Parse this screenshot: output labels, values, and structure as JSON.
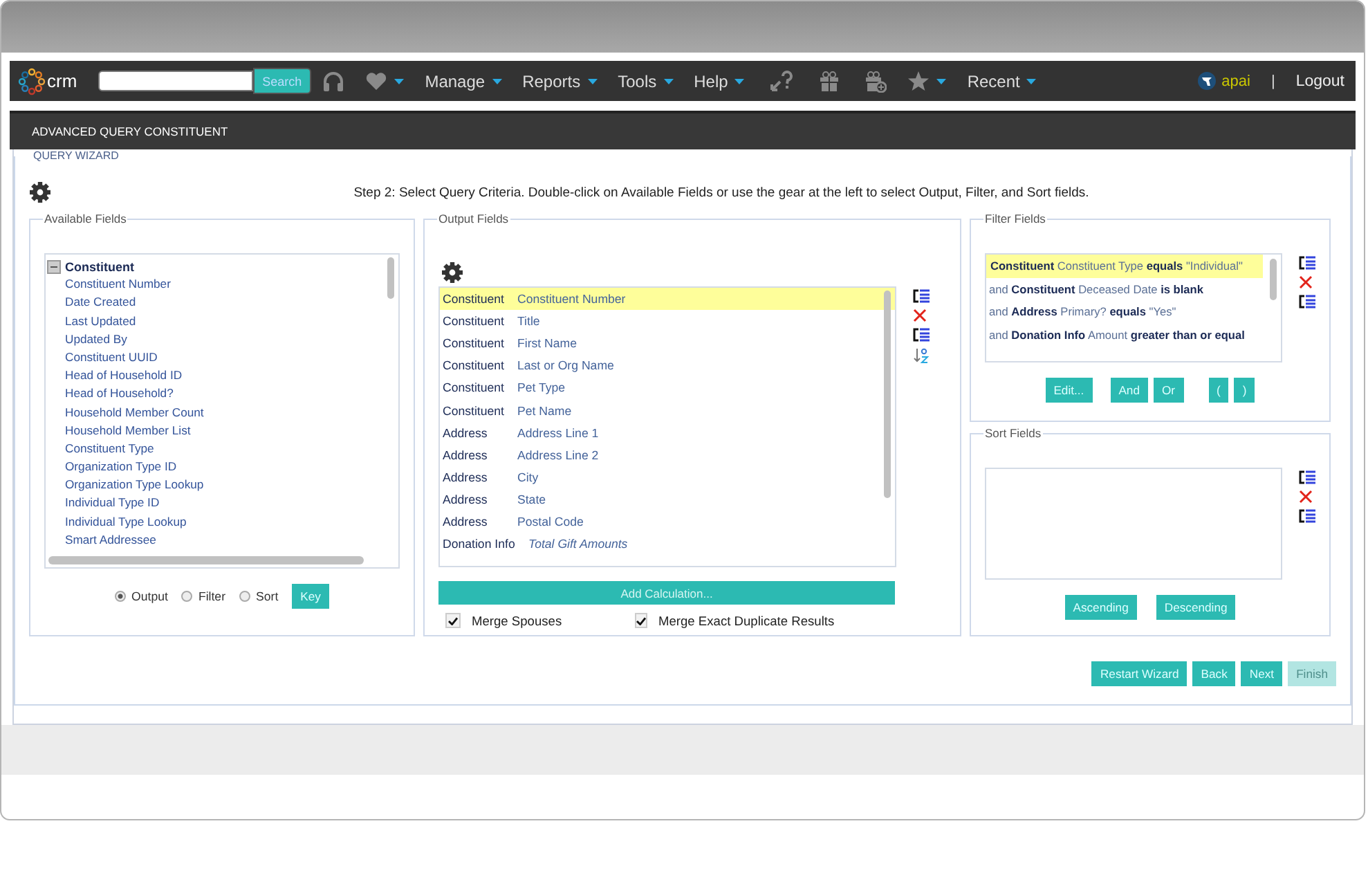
{
  "navbar": {
    "logo": "crm",
    "search": {
      "button": "Search"
    },
    "menus": [
      {
        "kind": "icon"
      },
      {
        "kind": "text",
        "label": "Manage"
      },
      {
        "kind": "text",
        "label": "Reports"
      },
      {
        "kind": "text",
        "label": "Tools"
      },
      {
        "kind": "text",
        "label": "Help"
      }
    ],
    "recent": "Recent",
    "user": "apai",
    "separator": "|",
    "logout": "Logout"
  },
  "page_title": "ADVANCED QUERY CONSTITUENT",
  "wizard": {
    "title": "QUERY WIZARD",
    "instructions": "Step 2: Select Query Criteria. Double-click on Available Fields or use the gear at the left to select Output, Filter, and Sort fields.",
    "available_fields": {
      "title": "Available Fields",
      "tree": [
        {
          "label": "Constituent",
          "expanded": true,
          "children": [
            {
              "label": "Constituent Number"
            },
            {
              "label": "Date Created"
            },
            {
              "label": "Last Updated"
            },
            {
              "label": "Updated By"
            },
            {
              "label": "Constituent UUID"
            },
            {
              "label": "Head of Household ID"
            },
            {
              "label": "Head of Household?"
            },
            {
              "label": "Household Member Count"
            },
            {
              "label": "Household Member List"
            },
            {
              "label": "Constituent Type"
            },
            {
              "label": "Organization Type ID"
            },
            {
              "label": "Organization Type Lookup"
            },
            {
              "label": "Individual Type ID"
            },
            {
              "label": "Individual Type Lookup"
            },
            {
              "label": "Smart Addressee"
            }
          ]
        }
      ],
      "targets": [
        {
          "label": "Output",
          "selected": true
        },
        {
          "label": "Filter",
          "selected": false
        },
        {
          "label": "Sort",
          "selected": false
        }
      ],
      "key_button": "Key"
    },
    "output_fields": {
      "title": "Output Fields",
      "rows": [
        {
          "entity": "Constituent",
          "field": "Constituent Number",
          "kind": "field",
          "selected": true
        },
        {
          "entity": "Constituent",
          "field": "Title",
          "kind": "field",
          "selected": false
        },
        {
          "entity": "Constituent",
          "field": "First Name",
          "kind": "field",
          "selected": false
        },
        {
          "entity": "Constituent",
          "field": "Last or Org Name",
          "kind": "field",
          "selected": false
        },
        {
          "entity": "Constituent",
          "field": "Pet Type",
          "kind": "field",
          "selected": false
        },
        {
          "entity": "Constituent",
          "field": "Pet Name",
          "kind": "field",
          "selected": false
        },
        {
          "entity": "Address",
          "field": "Address Line 1",
          "kind": "field",
          "selected": false
        },
        {
          "entity": "Address",
          "field": "Address Line 2",
          "kind": "field",
          "selected": false
        },
        {
          "entity": "Address",
          "field": "City",
          "kind": "field",
          "selected": false
        },
        {
          "entity": "Address",
          "field": "State",
          "kind": "field",
          "selected": false
        },
        {
          "entity": "Address",
          "field": "Postal Code",
          "kind": "field",
          "selected": false
        },
        {
          "entity": "Donation Info",
          "field": "Total Gift Amounts",
          "kind": "calculation",
          "selected": false
        }
      ],
      "add_calculation": "Add Calculation...",
      "options": [
        {
          "label": "Merge Spouses",
          "checked": true
        },
        {
          "label": "Merge Exact Duplicate Results",
          "checked": true
        }
      ]
    },
    "filter_fields": {
      "title": "Filter Fields",
      "rows": [
        {
          "entity": "Constituent",
          "field": "Constituent Type",
          "operator": "equals",
          "value": "\"Individual\"",
          "selected": true
        },
        {
          "conjunction": "and",
          "entity": "Constituent",
          "field": "Deceased Date",
          "operator": "is blank",
          "selected": false
        },
        {
          "conjunction": "and",
          "entity": "Address",
          "field": "Primary?",
          "operator": "equals",
          "value": "\"Yes\"",
          "selected": false
        },
        {
          "conjunction": "and",
          "entity": "Donation Info",
          "field": "Amount",
          "operator": "greater than or equal",
          "selected": false
        }
      ],
      "buttons": [
        "Edit...",
        "And",
        "Or",
        "(",
        ")"
      ]
    },
    "sort_fields": {
      "title": "Sort Fields",
      "buttons": [
        "Ascending",
        "Descending"
      ]
    },
    "nav_buttons": [
      {
        "label": "Restart Wizard",
        "disabled": false
      },
      {
        "label": "Back",
        "disabled": false
      },
      {
        "label": "Next",
        "disabled": false
      },
      {
        "label": "Finish",
        "disabled": true
      }
    ]
  }
}
